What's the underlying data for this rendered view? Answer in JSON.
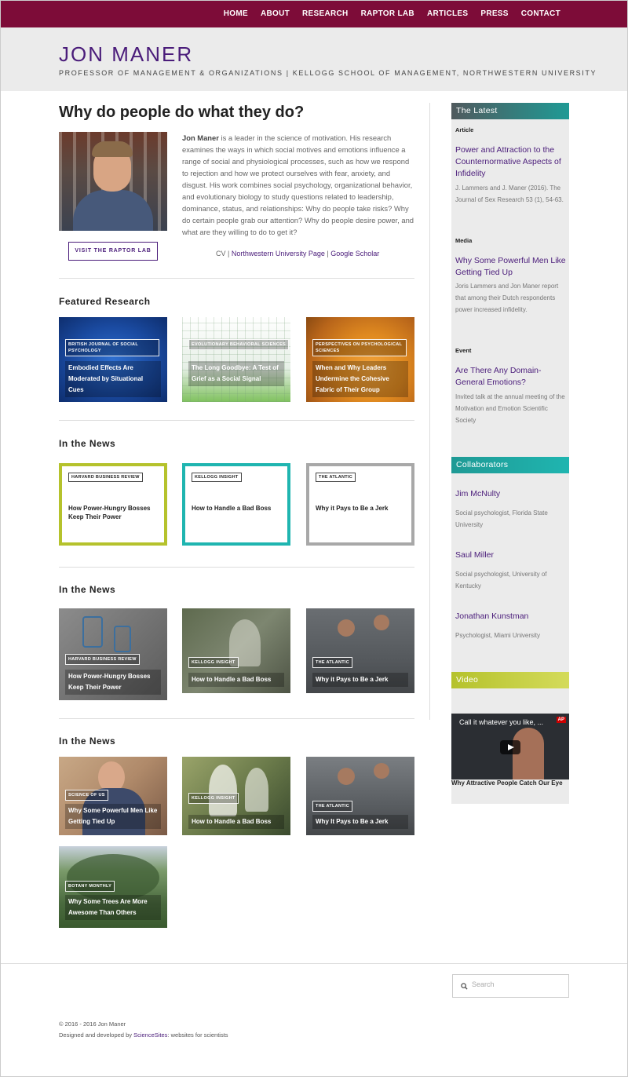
{
  "nav": [
    "HOME",
    "ABOUT",
    "RESEARCH",
    "RAPTOR LAB",
    "ARTICLES",
    "PRESS",
    "CONTACT"
  ],
  "site": {
    "title": "JON MANER",
    "tagline": "PROFESSOR OF MANAGEMENT & ORGANIZATIONS | KELLOGG SCHOOL OF MANAGEMENT, NORTHWESTERN UNIVERSITY"
  },
  "intro": {
    "heading": "Why do people do what they do?",
    "name": "Jon Maner",
    "bio": " is a leader in the science of motivation. His research examines the ways in which social motives and emotions influence a range of social and physiological processes, such as how we respond to rejection and how we protect ourselves with fear, anxiety, and disgust. His work combines social psychology, organizational behavior, and evolutionary biology to study questions related to leadership, dominance, status, and relationships: Why do people take risks? Why do certain people grab our attention? Why do people desire power, and what are they willing to do to get it?",
    "button": "VISIT THE RAPTOR LAB",
    "links": {
      "cv": "CV",
      "sep1": " | ",
      "nu": "Northwestern University Page",
      "sep2": " | ",
      "scholar": "Google Scholar"
    }
  },
  "featured": {
    "title": "Featured Research",
    "cards": [
      {
        "source": "BRITISH JOURNAL OF SOCIAL PSYCHOLOGY",
        "title": "Embodied Effects Are Moderated by Situational Cues"
      },
      {
        "source": "EVOLUTIONARY BEHAVIORAL SCIENCES",
        "title": "The Long Goodbye: A Test of Grief as a Social Signal"
      },
      {
        "source": "PERSPECTIVES ON PSYCHOLOGICAL SCIENCES",
        "title": "When and Why Leaders Undermine the Cohesive Fabric of Their Group"
      }
    ]
  },
  "news1": {
    "title": "In the News",
    "items": [
      {
        "source": "HARVARD BUSINESS REVIEW",
        "title": "How Power-Hungry Bosses Keep Their Power",
        "color": "#b5c22c"
      },
      {
        "source": "KELLOGG INSIGHT",
        "title": "How to Handle a Bad Boss",
        "color": "#1fb5b0"
      },
      {
        "source": "THE ATLANTIC",
        "title": "Why it Pays to Be a Jerk",
        "color": "#a8a8a8"
      }
    ]
  },
  "news2": {
    "title": "In the News",
    "items": [
      {
        "source": "HARVARD BUSINESS REVIEW",
        "title": "How Power-Hungry Bosses Keep Their Power"
      },
      {
        "source": "KELLOGG INSIGHT",
        "title": "How to Handle a Bad Boss"
      },
      {
        "source": "THE ATLANTIC",
        "title": "Why it Pays to Be a Jerk"
      }
    ]
  },
  "news3": {
    "title": "In the News",
    "items": [
      {
        "source": "SCIENCE OF US",
        "title": "Why Some Powerful Men Like Getting Tied Up"
      },
      {
        "source": "KELLOGG INSIGHT",
        "title": "How to Handle a Bad Boss"
      },
      {
        "source": "THE ATLANTIC",
        "title": "Why It Pays to Be a Jerk"
      },
      {
        "source": "BOTANY MONTHLY",
        "title": "Why Some Trees Are More Awesome Than Others"
      }
    ]
  },
  "sidebar": {
    "latest": {
      "title": "The Latest",
      "entries": [
        {
          "category": "Article",
          "title": "Power and Attraction to the Counternormative Aspects of Infidelity",
          "text": "J. Lammers and J. Maner (2016). The Journal of Sex Research 53 (1), 54-63."
        },
        {
          "category": "Media",
          "title": "Why Some Powerful Men Like Getting Tied Up",
          "text": "Joris Lammers and Jon Maner report that among their Dutch respondents power increased infidelity."
        },
        {
          "category": "Event",
          "title": "Are There Any Domain-General Emotions?",
          "text": "Invited talk at the annual meeting of the Motivation and Emotion Scientific Society"
        }
      ]
    },
    "collaborators": {
      "title": "Collaborators",
      "people": [
        {
          "name": "Jim McNulty",
          "role": "Social psychologist, Florida State University"
        },
        {
          "name": "Saul Miller",
          "role": "Social psychologist, University of Kentucky"
        },
        {
          "name": "Jonathan Kunstman",
          "role": "Psychologist, Miami University"
        }
      ]
    },
    "video": {
      "title": "Video",
      "overlay": "Call it whatever you like, ...",
      "badge": "AP",
      "caption": "Why Attractive People Catch Our Eye"
    }
  },
  "footer": {
    "search_placeholder": "Search",
    "copyright": "© 2016 - 2016 Jon Maner",
    "credit_pre": "Designed and developed by ",
    "credit_link": "ScienceSites",
    "credit_post": ": websites for scientists"
  },
  "colors": {
    "nav_bg": "#7d0c38",
    "accent": "#4a1c7a",
    "latest_header": "#1f9a95",
    "collab_header": "#1fb5b0",
    "video_header": "#b5c22c"
  }
}
